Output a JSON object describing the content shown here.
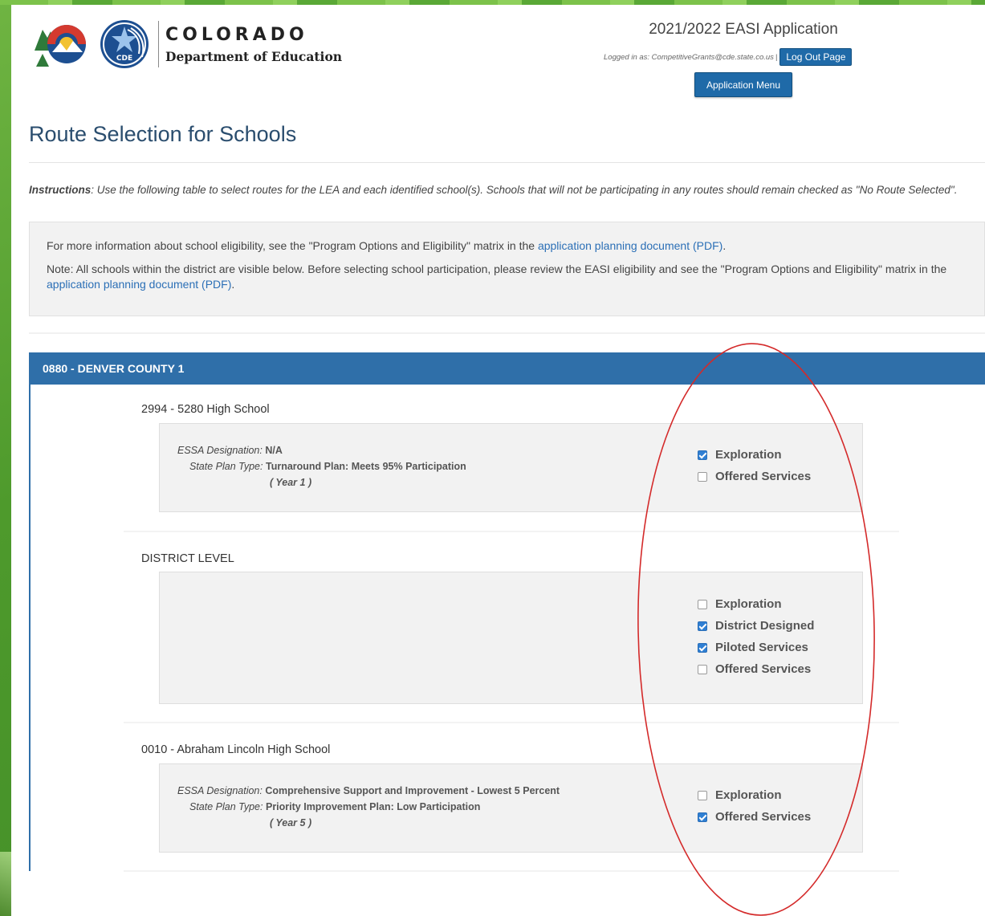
{
  "header": {
    "brand_name": "COLORADO",
    "brand_subtitle": "Department of Education",
    "cde_badge": "CDE",
    "app_title": "2021/2022 EASI Application",
    "logged_in_text": "Logged in as: CompetitiveGrants@cde.state.co.us",
    "logged_in_sep": "|",
    "logout_label": "Log Out Page",
    "app_menu_label": "Application Menu"
  },
  "page": {
    "title": "Route Selection for Schools",
    "instructions_label": "Instructions",
    "instructions_text": ": Use the following table to select routes for the LEA and each identified school(s). Schools that will not be participating in any routes should remain checked as \"No Route Selected\"."
  },
  "info": {
    "line1_text": "For more information about school eligibility, see the \"Program Options and Eligibility\" matrix in the ",
    "line1_link": "application planning document (PDF)",
    "line1_end": ".",
    "line2_text": "Note: All schools within the district are visible below. Before selecting school participation, please review the EASI eligibility and see the \"Program Options and Eligibility\" matrix in the ",
    "line2_link": "application planning document (PDF)",
    "line2_end": "."
  },
  "lea": {
    "header": "0880 - DENVER COUNTY 1",
    "schools": [
      {
        "name": "2994 - 5280 High School",
        "essa_label": "ESSA Designation:",
        "essa_value": "N/A",
        "plan_label": "State Plan Type:",
        "plan_value": "Turnaround Plan: Meets 95% Participation",
        "year": "( Year 1 )",
        "routes": [
          {
            "label": "Exploration",
            "checked": true
          },
          {
            "label": "Offered Services",
            "checked": false
          }
        ]
      },
      {
        "name": "DISTRICT LEVEL",
        "routes": [
          {
            "label": "Exploration",
            "checked": false
          },
          {
            "label": "District Designed",
            "checked": true
          },
          {
            "label": "Piloted Services",
            "checked": true
          },
          {
            "label": "Offered Services",
            "checked": false
          }
        ]
      },
      {
        "name": "0010 - Abraham Lincoln High School",
        "essa_label": "ESSA Designation:",
        "essa_value": "Comprehensive Support and Improvement - Lowest 5 Percent",
        "plan_label": "State Plan Type:",
        "plan_value": "Priority Improvement Plan: Low Participation",
        "year": "( Year 5 )",
        "routes": [
          {
            "label": "Exploration",
            "checked": false
          },
          {
            "label": "Offered Services",
            "checked": true
          }
        ]
      }
    ]
  },
  "colors": {
    "accent_blue": "#2f6fa9",
    "button_blue": "#1f6aa8",
    "frame_green": "#5a9c3a",
    "annotation_red": "#d42a2a"
  }
}
